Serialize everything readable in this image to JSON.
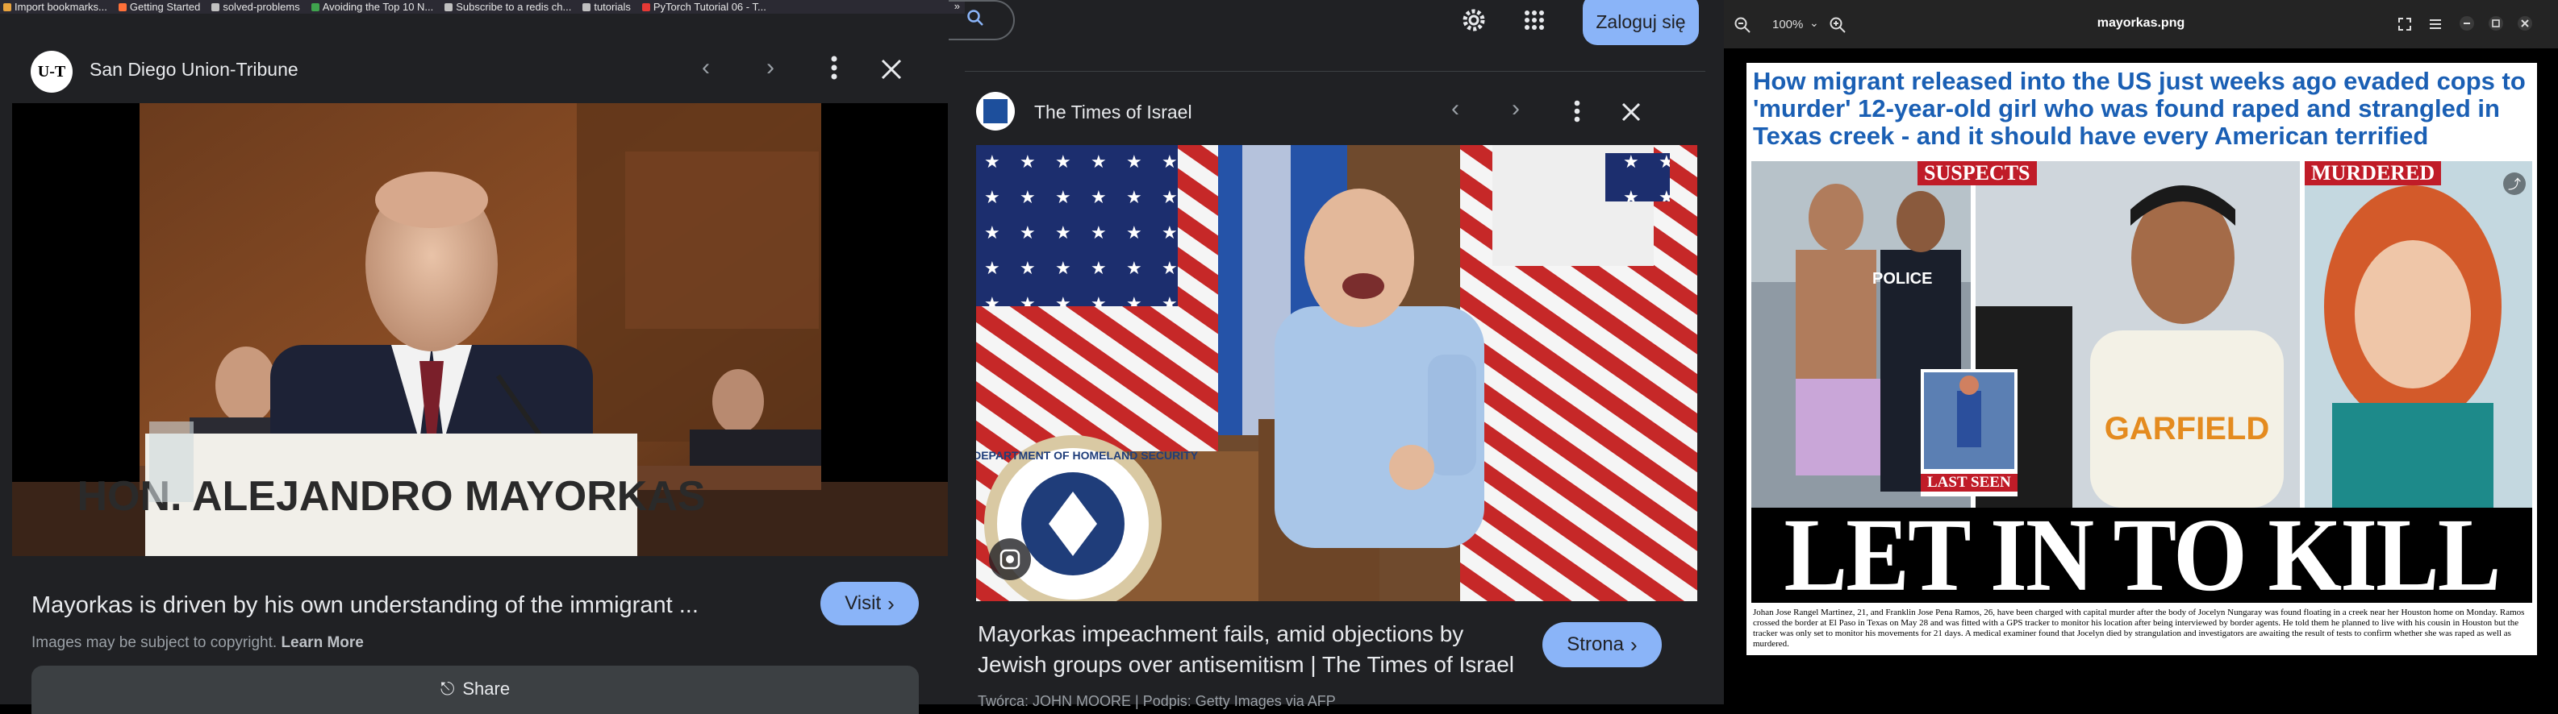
{
  "bookmarks": [
    {
      "label": "Import bookmarks...",
      "icon": "import-icon",
      "color": "#e8a33d"
    },
    {
      "label": "Getting Started",
      "icon": "firefox-icon",
      "color": "#ff7139"
    },
    {
      "label": "solved-problems",
      "icon": "folder-icon",
      "color": "#c0c0c0"
    },
    {
      "label": "Avoiding the Top 10 N...",
      "icon": "n-logo-icon",
      "color": "#3fa34d"
    },
    {
      "label": "Subscribe to a redis ch...",
      "icon": "globe-icon",
      "color": "#c0c0c0"
    },
    {
      "label": "tutorials",
      "icon": "folder-icon",
      "color": "#c0c0c0"
    },
    {
      "label": "PyTorch Tutorial 06 - T...",
      "icon": "youtube-icon",
      "color": "#e53935"
    }
  ],
  "panel1": {
    "source": "San Diego Union-Tribune",
    "logo_text": "U-T",
    "podium_text": "HON. ALEJANDRO MAYORKAS",
    "caption": "Mayorkas is driven by his own understanding of the immigrant ...",
    "visit_label": "Visit",
    "copyright_text": "Images may be subject to copyright.",
    "learn_more": "Learn More",
    "share_label": "Share"
  },
  "panel2": {
    "login_label": "Zaloguj się",
    "source": "The Times of Israel",
    "seal_text": "U.S. DEPARTMENT OF HOMELAND SECURITY",
    "caption": "Mayorkas impeachment fails, amid objections by Jewish groups over antisemitism | The Times of Israel",
    "visit_label": "Strona",
    "credit": "Twórca: JOHN MOORE | Podpis: Getty Images via AFP"
  },
  "panel3": {
    "zoom": "100%",
    "filename": "mayorkas.png",
    "headline": "How migrant released into the US just weeks ago evaded cops to 'murder' 12-year-old girl who was found raped and strangled in Texas creek - and it should have every American terrified",
    "tag_suspects": "SUSPECTS",
    "tag_murdered": "MURDERED",
    "tag_last_seen": "LAST SEEN",
    "police_text": "POLICE",
    "shirt_text": "GARFIELD",
    "big_title": "LET IN TO KILL",
    "body": "Johan Jose Rangel Martinez, 21, and Franklin Jose Pena Ramos, 26, have been charged with capital murder after the body of Jocelyn Nungaray was found floating in a creek near her Houston home on Monday. Ramos crossed the border at El Paso in Texas on May 28 and was fitted with a GPS tracker to monitor his location after being interviewed by border agents. He told them he planned to live with his cousin in Houston but the tracker was only set to monitor his movements for 21 days. A medical examiner found that Jocelyn died by strangulation and investigators are awaiting the result of tests to confirm whether she was raped as well as murdered."
  },
  "colors": {
    "panel_bg": "#202124",
    "accent_blue": "#8ab4f8",
    "headline_blue": "#1a5fb4",
    "tag_red": "#c01c28"
  }
}
